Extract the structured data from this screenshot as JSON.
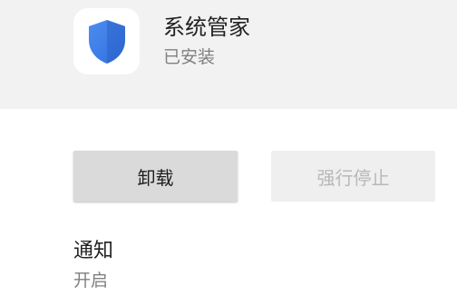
{
  "app": {
    "name": "系统管家",
    "status": "已安装",
    "icon": "shield-icon",
    "icon_color": "#3b7be8"
  },
  "actions": {
    "uninstall_label": "卸载",
    "force_stop_label": "强行停止"
  },
  "notifications": {
    "title": "通知",
    "value": "开启"
  }
}
